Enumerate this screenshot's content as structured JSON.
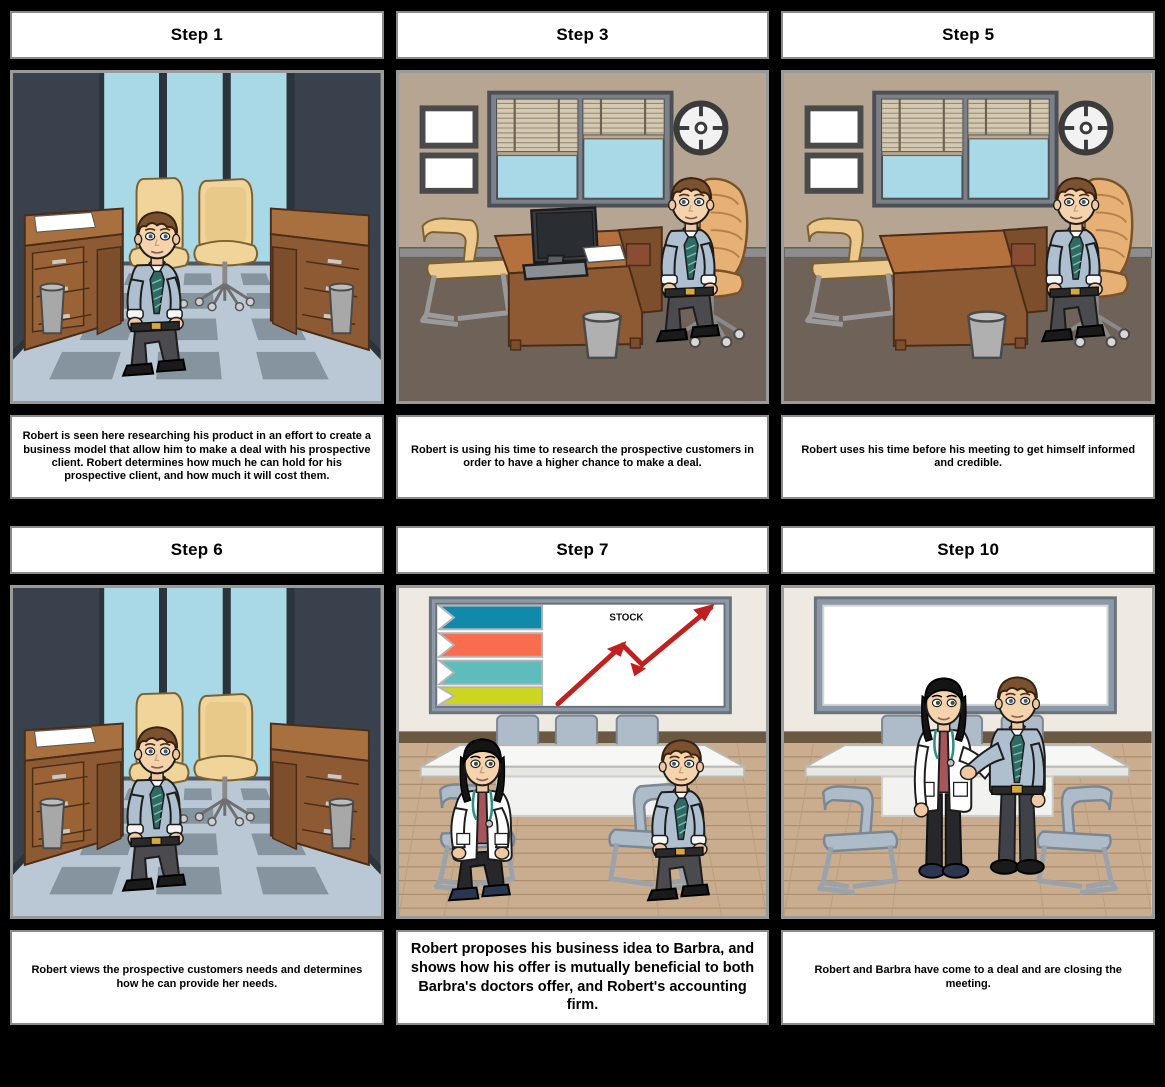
{
  "storyboard": {
    "background_color": "#000000",
    "panel_border_color": "#8a8a8a",
    "rows": 2,
    "columns": 3
  },
  "panels": [
    {
      "title": "Step 1",
      "caption": "Robert is seen here researching his product in an effort to create a business model that allow him to make a deal with his prospective client. Robert determines how much he can hold for his prospective client, and how much it will cost them.",
      "caption_size": "small",
      "scene": "office-desk-window-room",
      "scene_description": "Dark blue office with floor-to-ceiling windows, two wooden desks, checkered tile floor, man in blue shirt and green tie seated in tan office chair, empty tan chair, two grey trash bins, white paper on desk"
    },
    {
      "title": "Step 3",
      "caption": "Robert is using his time to research the prospective customers in order to have a higher chance to make a deal.",
      "caption_size": "small",
      "scene": "office-blinds-monitor",
      "scene_description": "Tan office with venetian blind windows, wall clock, two empty picture frames, wooden desk with computer monitor and paper, visitor chair, trash bin, man seated in tan executive chair"
    },
    {
      "title": "Step 5",
      "caption": "Robert uses his time before his meeting to get himself informed and credible.",
      "caption_size": "small",
      "scene": "office-blinds-clear-desk",
      "scene_description": "Tan office with venetian blind windows, wall clock, two empty picture frames, clear wooden desk, visitor chair, trash bin, man seated in tan executive chair"
    },
    {
      "title": "Step 6",
      "caption": "Robert views the prospective customers needs and determines how he can provide her needs.",
      "caption_size": "small",
      "scene": "office-desk-window-room",
      "scene_description": "Dark blue office with floor-to-ceiling windows, two wooden desks, checkered tile floor, man seated in tan office chair, empty tan chair, two grey trash bins"
    },
    {
      "title": "Step 7",
      "caption": "Robert proposes his business idea to Barbra, and shows how his offer is mutually beneficial to both Barbra's doctors offer, and Robert's accounting firm.",
      "caption_size": "large",
      "scene": "conference-room-presentation",
      "scene_description": "Conference room with wooden floor, white table, grey chairs, presentation board showing four colored chevron bars and a STOCK chart with red zigzag arrow; woman doctor in white coat seated left, businessman seated right"
    },
    {
      "title": "Step 10",
      "caption": "Robert and Barbra have come to a deal and are closing the meeting.",
      "caption_size": "small",
      "scene": "conference-room-handshake",
      "scene_description": "Conference room with wooden floor, white table, grey chairs, blank whiteboard; woman doctor in white coat and businessman shaking hands standing in the middle"
    }
  ],
  "presentation_board": {
    "chart_label": "STOCK",
    "chevron_colors": [
      "#1189aa",
      "#f96c4e",
      "#5fbcbc",
      "#cdd61e"
    ],
    "arrow_color": "#c0211f"
  },
  "chart_data": {
    "type": "line",
    "title": "STOCK",
    "x": [
      0,
      1,
      2,
      3
    ],
    "values": [
      5,
      60,
      38,
      95
    ],
    "series": [
      {
        "name": "STOCK",
        "values": [
          5,
          60,
          38,
          95
        ]
      }
    ],
    "xlabel": "",
    "ylabel": "",
    "ylim": [
      0,
      100
    ],
    "grid": false,
    "legend": "none",
    "annotations": [
      "upward trending red zigzag arrow"
    ]
  },
  "palette": {
    "office_wall_dark": "#3d4650",
    "office_window_sky": "#a9d8e6",
    "office_floor_light": "#b9c8d4",
    "office_floor_dark": "#6f7d88",
    "desk_wood": "#8d5a34",
    "desk_wood_top": "#a9703f",
    "chair_tan": "#f0d49a",
    "wall_tan": "#b7a593",
    "floor_brown": "#6f6259",
    "wood_floor": "#c9ad8e",
    "table_white": "#f2f2f0",
    "chair_grey": "#aebcc9",
    "shirt_blue": "#aebfd0",
    "tie_green": "#2f6a63",
    "pants_grey": "#4a4a4f",
    "coat_white": "#ffffff",
    "scrub_red": "#a4565a",
    "hair_brown": "#7b5230",
    "hair_black": "#141414"
  }
}
